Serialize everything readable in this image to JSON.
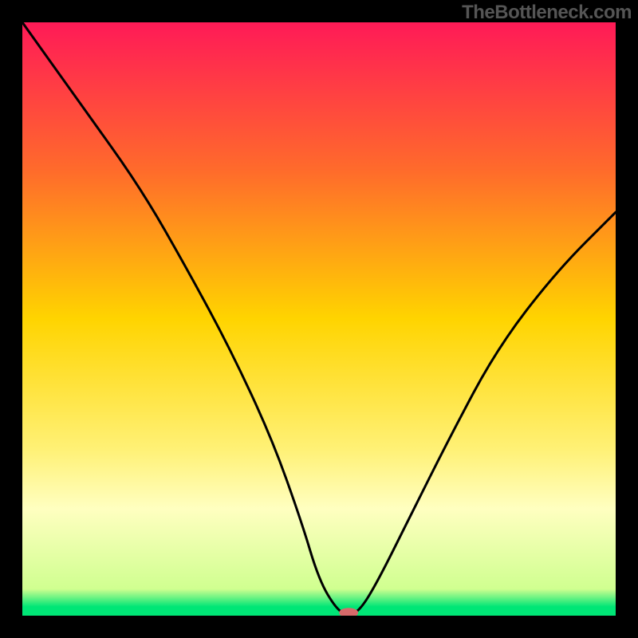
{
  "watermark": "TheBottleneck.com",
  "chart_data": {
    "type": "line",
    "title": "",
    "xlabel": "",
    "ylabel": "",
    "xlim": [
      0,
      100
    ],
    "ylim": [
      0,
      100
    ],
    "gradient_stops": [
      {
        "offset": 0,
        "color": "#ff1a57"
      },
      {
        "offset": 0.25,
        "color": "#ff6b2b"
      },
      {
        "offset": 0.5,
        "color": "#ffd400"
      },
      {
        "offset": 0.72,
        "color": "#fff176"
      },
      {
        "offset": 0.82,
        "color": "#ffffc0"
      },
      {
        "offset": 0.955,
        "color": "#d0ff90"
      },
      {
        "offset": 0.985,
        "color": "#00e676"
      }
    ],
    "series": [
      {
        "name": "bottleneck-curve",
        "x": [
          0,
          10,
          20,
          28,
          35,
          42,
          47,
          50,
          53,
          55,
          57,
          60,
          65,
          72,
          80,
          90,
          100
        ],
        "y": [
          100,
          86,
          72,
          58,
          45,
          30,
          16,
          6,
          1,
          0,
          1,
          6,
          16,
          30,
          45,
          58,
          68
        ]
      }
    ],
    "marker": {
      "name": "optimum-marker",
      "x": 55,
      "y": 0.5,
      "color": "#d66a6a",
      "rx": 12,
      "ry": 6
    }
  }
}
